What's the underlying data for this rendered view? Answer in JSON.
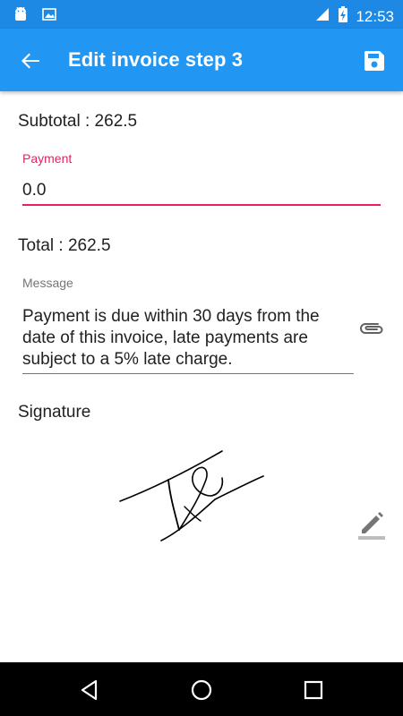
{
  "status_bar": {
    "time": "12:53",
    "icons": [
      "android-icon",
      "image-icon",
      "signal-icon",
      "battery-charging-icon"
    ]
  },
  "app_bar": {
    "title": "Edit invoice step 3",
    "back_icon": "arrow-back-icon",
    "save_icon": "save-icon"
  },
  "form": {
    "subtotal": "Subtotal : 262.5",
    "payment_label": "Payment",
    "payment_value": "0.0",
    "total": "Total : 262.5",
    "message_label": "Message",
    "message_value": "Payment is due within 30 days from the date of this invoice, late payments are subject to a 5% late charge.",
    "signature_label": "Signature"
  },
  "colors": {
    "status_bar": "#1e88e5",
    "app_bar": "#2196f3",
    "accent": "#e91e63"
  },
  "nav_bar": {
    "icons": [
      "back-triangle-icon",
      "home-circle-icon",
      "recents-square-icon"
    ]
  }
}
